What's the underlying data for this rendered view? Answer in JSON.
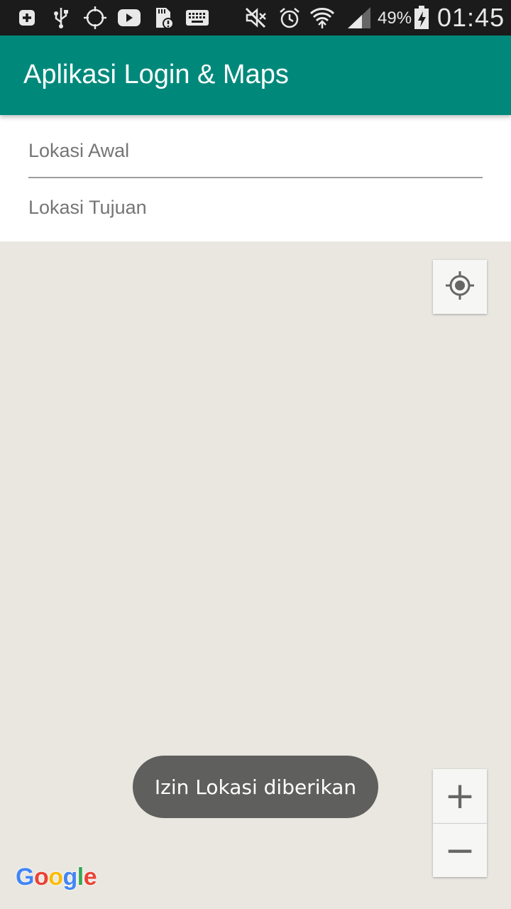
{
  "status_bar": {
    "icons": [
      "add-box-icon",
      "usb-icon",
      "gps-icon",
      "youtube-icon",
      "sd-card-alert-icon",
      "keyboard-icon",
      "mute-icon",
      "alarm-icon",
      "wifi-icon",
      "signal-icon",
      "battery-icon"
    ],
    "battery_percent": "49%",
    "time": "01:45"
  },
  "appbar": {
    "title": "Aplikasi Login & Maps",
    "color": "#00897b"
  },
  "form": {
    "origin": {
      "value": "",
      "placeholder": "Lokasi Awal"
    },
    "destination": {
      "value": "",
      "placeholder": "Lokasi Tujuan"
    }
  },
  "map": {
    "background": "#e9e7e0",
    "controls": {
      "my_location_icon": "my-location-icon",
      "zoom_in_label": "+",
      "zoom_out_label": "−"
    },
    "toast": "Izin Lokasi diberikan",
    "logo": [
      "G",
      "o",
      "o",
      "g",
      "l",
      "e"
    ]
  }
}
